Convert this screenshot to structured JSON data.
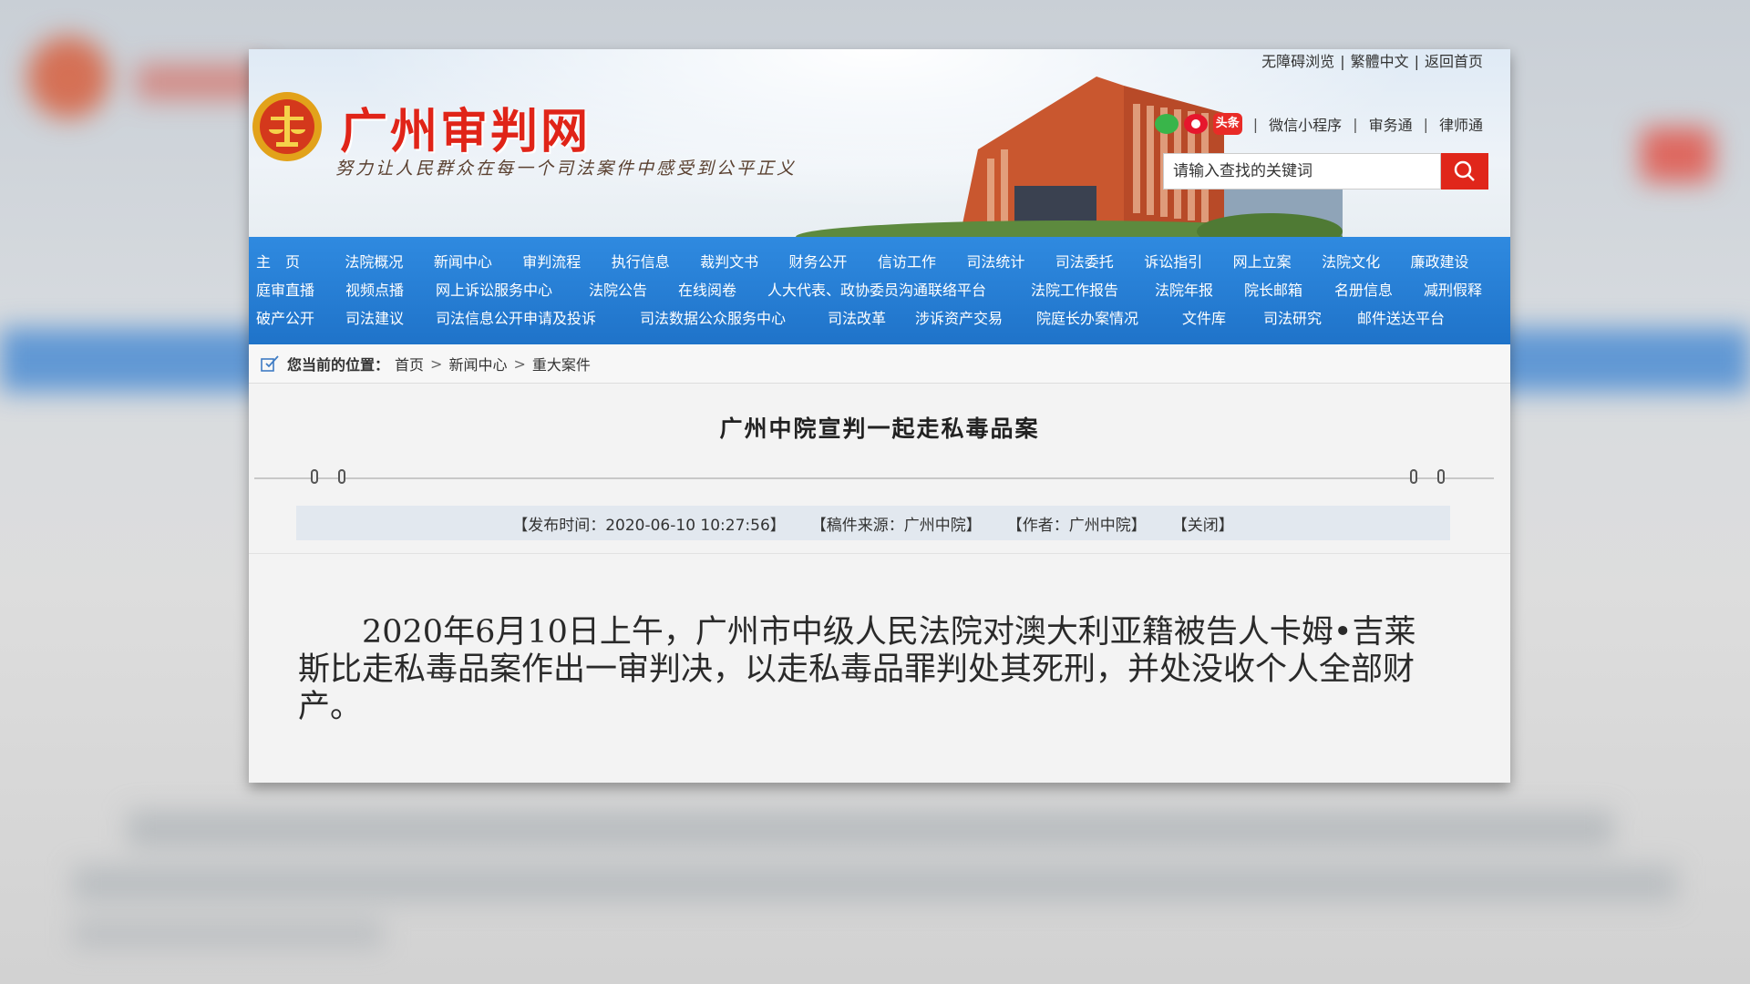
{
  "site": {
    "title": "广州审判网",
    "slogan": "努力让人民群众在每一个司法案件中感受到公平正义"
  },
  "top_links": [
    "无障碍浏览",
    "繁體中文",
    "返回首页"
  ],
  "social": {
    "toutiao_label": "头条",
    "links": [
      "微信小程序",
      "审务通",
      "律师通"
    ]
  },
  "search": {
    "placeholder": "请输入查找的关键词"
  },
  "nav": {
    "row1": [
      "主　页",
      "法院概况",
      "新闻中心",
      "审判流程",
      "执行信息",
      "裁判文书",
      "财务公开",
      "信访工作",
      "司法统计",
      "司法委托",
      "诉讼指引",
      "网上立案",
      "法院文化",
      "廉政建设"
    ],
    "row2": [
      "庭审直播",
      "视频点播",
      "网上诉讼服务中心",
      "法院公告",
      "在线阅卷",
      "人大代表、政协委员沟通联络平台",
      "法院工作报告",
      "法院年报",
      "院长邮箱",
      "名册信息",
      "减刑假释"
    ],
    "row3": [
      "破产公开",
      "司法建议",
      "司法信息公开申请及投诉",
      "司法数据公众服务中心",
      "司法改革",
      "涉诉资产交易",
      "院庭长办案情况",
      "文件库",
      "司法研究",
      "邮件送达平台"
    ]
  },
  "breadcrumb": {
    "label": "您当前的位置：",
    "items": [
      "首页",
      "新闻中心",
      "重大案件"
    ]
  },
  "article": {
    "title": "广州中院宣判一起走私毒品案",
    "publish_time": "【发布时间：2020-06-10 10:27:56】",
    "source": "【稿件来源：广州中院】",
    "author": "【作者：广州中院】",
    "close": "【关闭】",
    "body": "2020年6月10日上午，广州市中级人民法院对澳大利亚籍被告人卡姆•吉莱斯比走私毒品案作出一审判决，以走私毒品罪判处其死刑，并处没收个人全部财产。"
  },
  "colors": {
    "brand_red": "#e02418",
    "nav_blue": "#2f8ae0",
    "meta_bg": "#e2e8ef"
  }
}
